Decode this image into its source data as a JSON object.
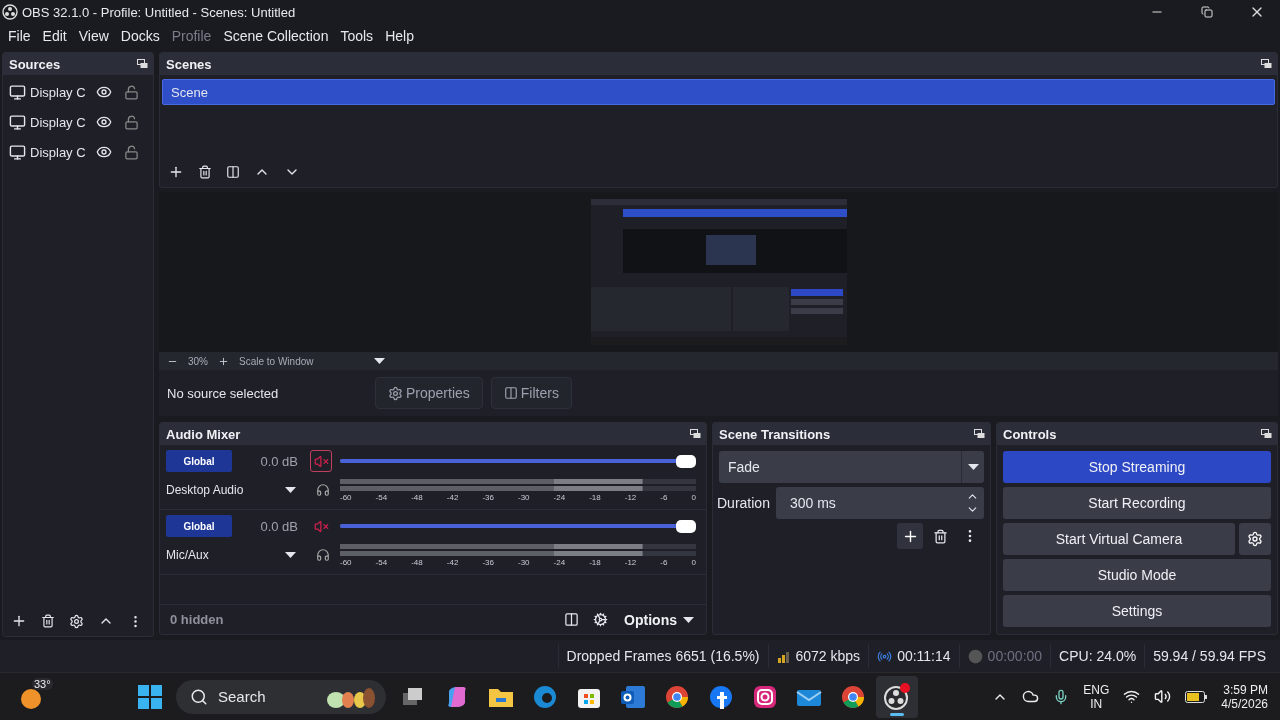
{
  "window": {
    "title": "OBS 32.1.0 - Profile: Untitled - Scenes: Untitled"
  },
  "menu": [
    {
      "label": "File",
      "disabled": false
    },
    {
      "label": "Edit",
      "disabled": false
    },
    {
      "label": "View",
      "disabled": false
    },
    {
      "label": "Docks",
      "disabled": false
    },
    {
      "label": "Profile",
      "disabled": true
    },
    {
      "label": "Scene Collection",
      "disabled": false
    },
    {
      "label": "Tools",
      "disabled": false
    },
    {
      "label": "Help",
      "disabled": false
    }
  ],
  "sources": {
    "title": "Sources",
    "items": [
      {
        "name": "Display C",
        "visible": true,
        "locked": false
      },
      {
        "name": "Display C",
        "visible": true,
        "locked": false
      },
      {
        "name": "Display C",
        "visible": true,
        "locked": false
      }
    ]
  },
  "scenes": {
    "title": "Scenes",
    "items": [
      {
        "name": "Scene",
        "selected": true
      }
    ]
  },
  "preview": {
    "zoom": "30%",
    "scale_mode": "Scale to Window"
  },
  "source_toolbar": {
    "status": "No source selected",
    "properties": "Properties",
    "filters": "Filters"
  },
  "audio_mixer": {
    "title": "Audio Mixer",
    "channels": [
      {
        "name": "Desktop Audio",
        "mode": "Global",
        "volume": "0.0 dB",
        "muted": true,
        "focused": true,
        "level": 1.0,
        "ticks": [
          "-60",
          "-54",
          "-48",
          "-42",
          "-36",
          "-30",
          "-24",
          "-18",
          "-12",
          "-6",
          "0"
        ]
      },
      {
        "name": "Mic/Aux",
        "mode": "Global",
        "volume": "0.0 dB",
        "muted": true,
        "focused": false,
        "level": 1.0,
        "ticks": [
          "-60",
          "-54",
          "-48",
          "-42",
          "-36",
          "-30",
          "-24",
          "-18",
          "-12",
          "-6",
          "0"
        ]
      }
    ],
    "hidden": "0 hidden",
    "options": "Options"
  },
  "transitions": {
    "title": "Scene Transitions",
    "transition": "Fade",
    "duration_label": "Duration",
    "duration": "300 ms"
  },
  "controls": {
    "title": "Controls",
    "buttons": [
      {
        "label": "Stop Streaming",
        "kind": "primary"
      },
      {
        "label": "Start Recording",
        "kind": "default"
      },
      {
        "label": "Start Virtual Camera",
        "kind": "with-settings"
      },
      {
        "label": "Studio Mode",
        "kind": "default"
      },
      {
        "label": "Settings",
        "kind": "default"
      }
    ]
  },
  "status_bar": {
    "dropped": "Dropped Frames 6651 (16.5%)",
    "bitrate": "6072 kbps",
    "stream_time": "00:11:14",
    "record_time": "00:00:00",
    "cpu": "CPU: 24.0%",
    "fps": "59.94 / 59.94 FPS"
  },
  "taskbar": {
    "weather": "33°",
    "search": "Search",
    "apps": [
      {
        "kind": "task-view",
        "selected": false
      },
      {
        "kind": "assistant",
        "selected": false
      },
      {
        "kind": "folder",
        "selected": false
      },
      {
        "kind": "edge",
        "selected": false
      },
      {
        "kind": "store",
        "selected": false
      },
      {
        "kind": "outlook",
        "selected": false
      },
      {
        "kind": "browser",
        "selected": false
      },
      {
        "kind": "round",
        "selected": false
      },
      {
        "kind": "camera",
        "selected": false
      },
      {
        "kind": "mail",
        "selected": false
      },
      {
        "kind": "browser",
        "selected": false
      },
      {
        "kind": "recorder",
        "selected": true
      }
    ],
    "language": "ENG",
    "region": "IN",
    "time": "3:59 PM",
    "date": "4/5/2026"
  }
}
